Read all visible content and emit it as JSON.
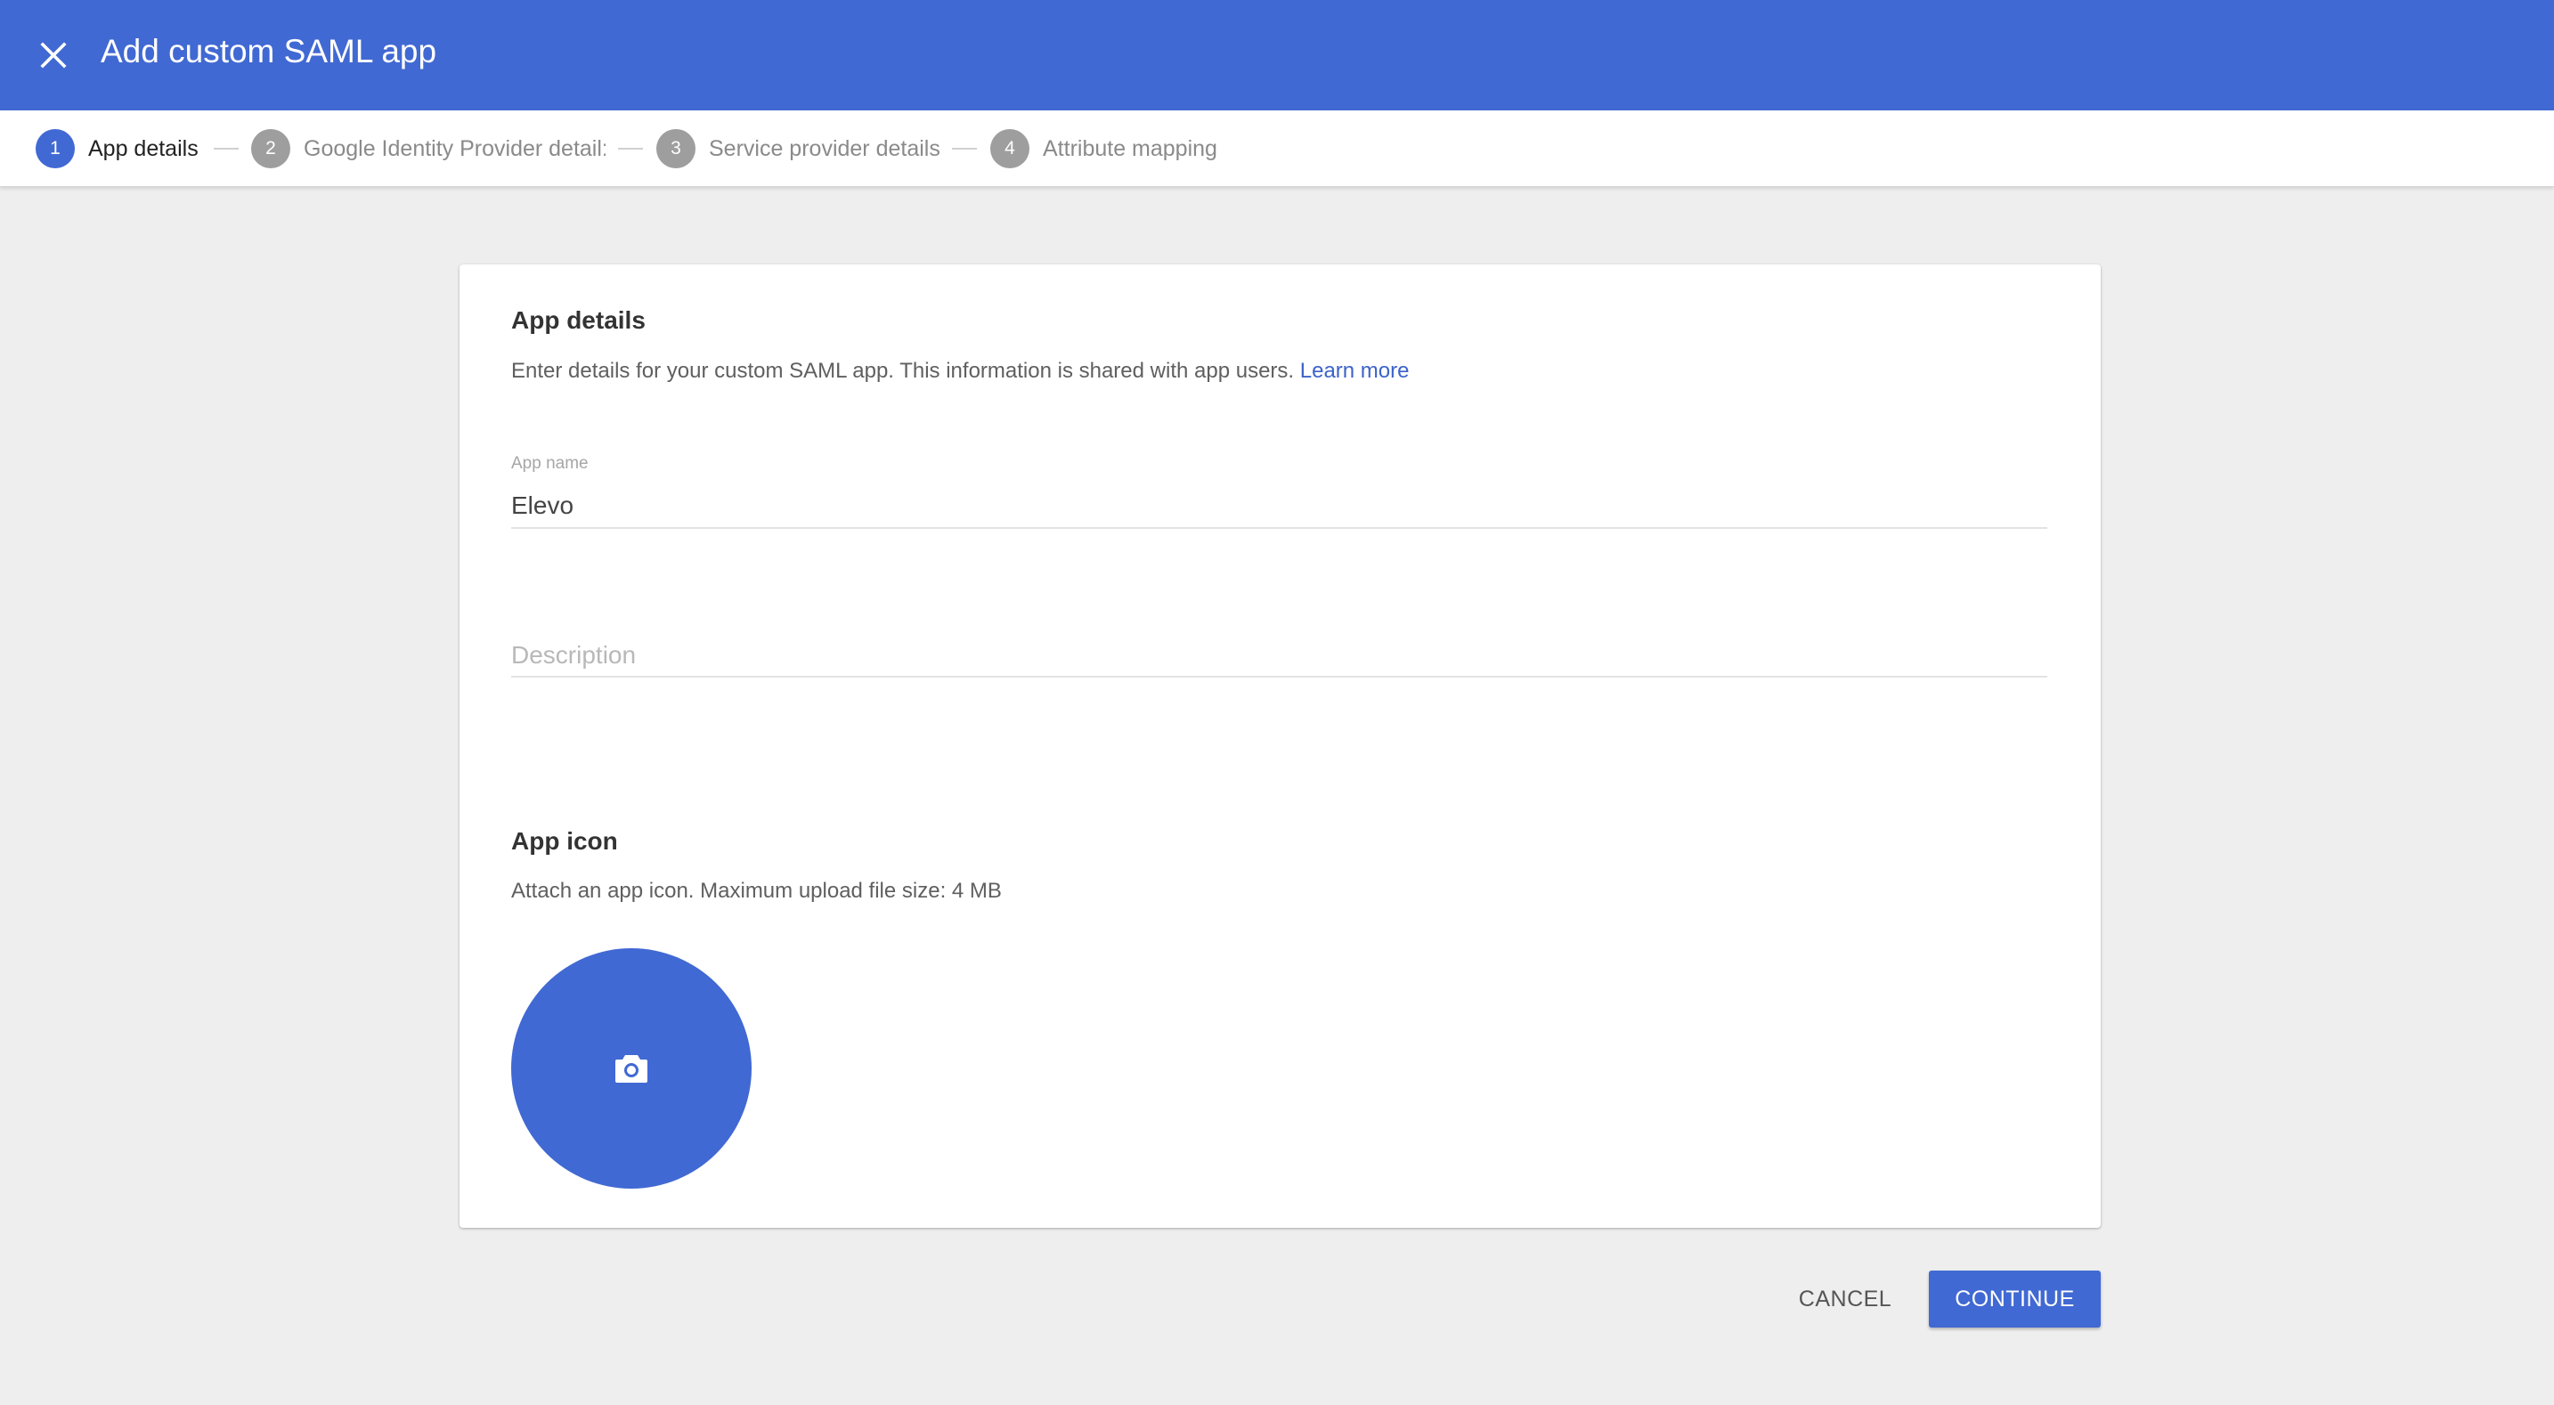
{
  "header": {
    "title": "Add custom SAML app",
    "close_icon": "close-icon",
    "background_color": "#4169d3"
  },
  "stepper": {
    "steps": [
      {
        "number": "1",
        "label": "App details",
        "active": true
      },
      {
        "number": "2",
        "label": "Google Identity Provider detail:",
        "active": false
      },
      {
        "number": "3",
        "label": "Service provider details",
        "active": false
      },
      {
        "number": "4",
        "label": "Attribute mapping",
        "active": false
      }
    ]
  },
  "app_details": {
    "title": "App details",
    "description": "Enter details for your custom SAML app. This information is shared with app users.",
    "learn_more": "Learn more",
    "app_name_label": "App name",
    "app_name_value": "Elevo",
    "description_placeholder": "Description"
  },
  "app_icon": {
    "title": "App icon",
    "description": "Attach an app icon. Maximum upload file size: 4 MB",
    "upload_icon": "camera-icon"
  },
  "actions": {
    "cancel_label": "CANCEL",
    "continue_label": "CONTINUE"
  },
  "colors": {
    "accent": "#4169d3",
    "link": "#3c63c9",
    "page_background": "#eeeeee"
  }
}
